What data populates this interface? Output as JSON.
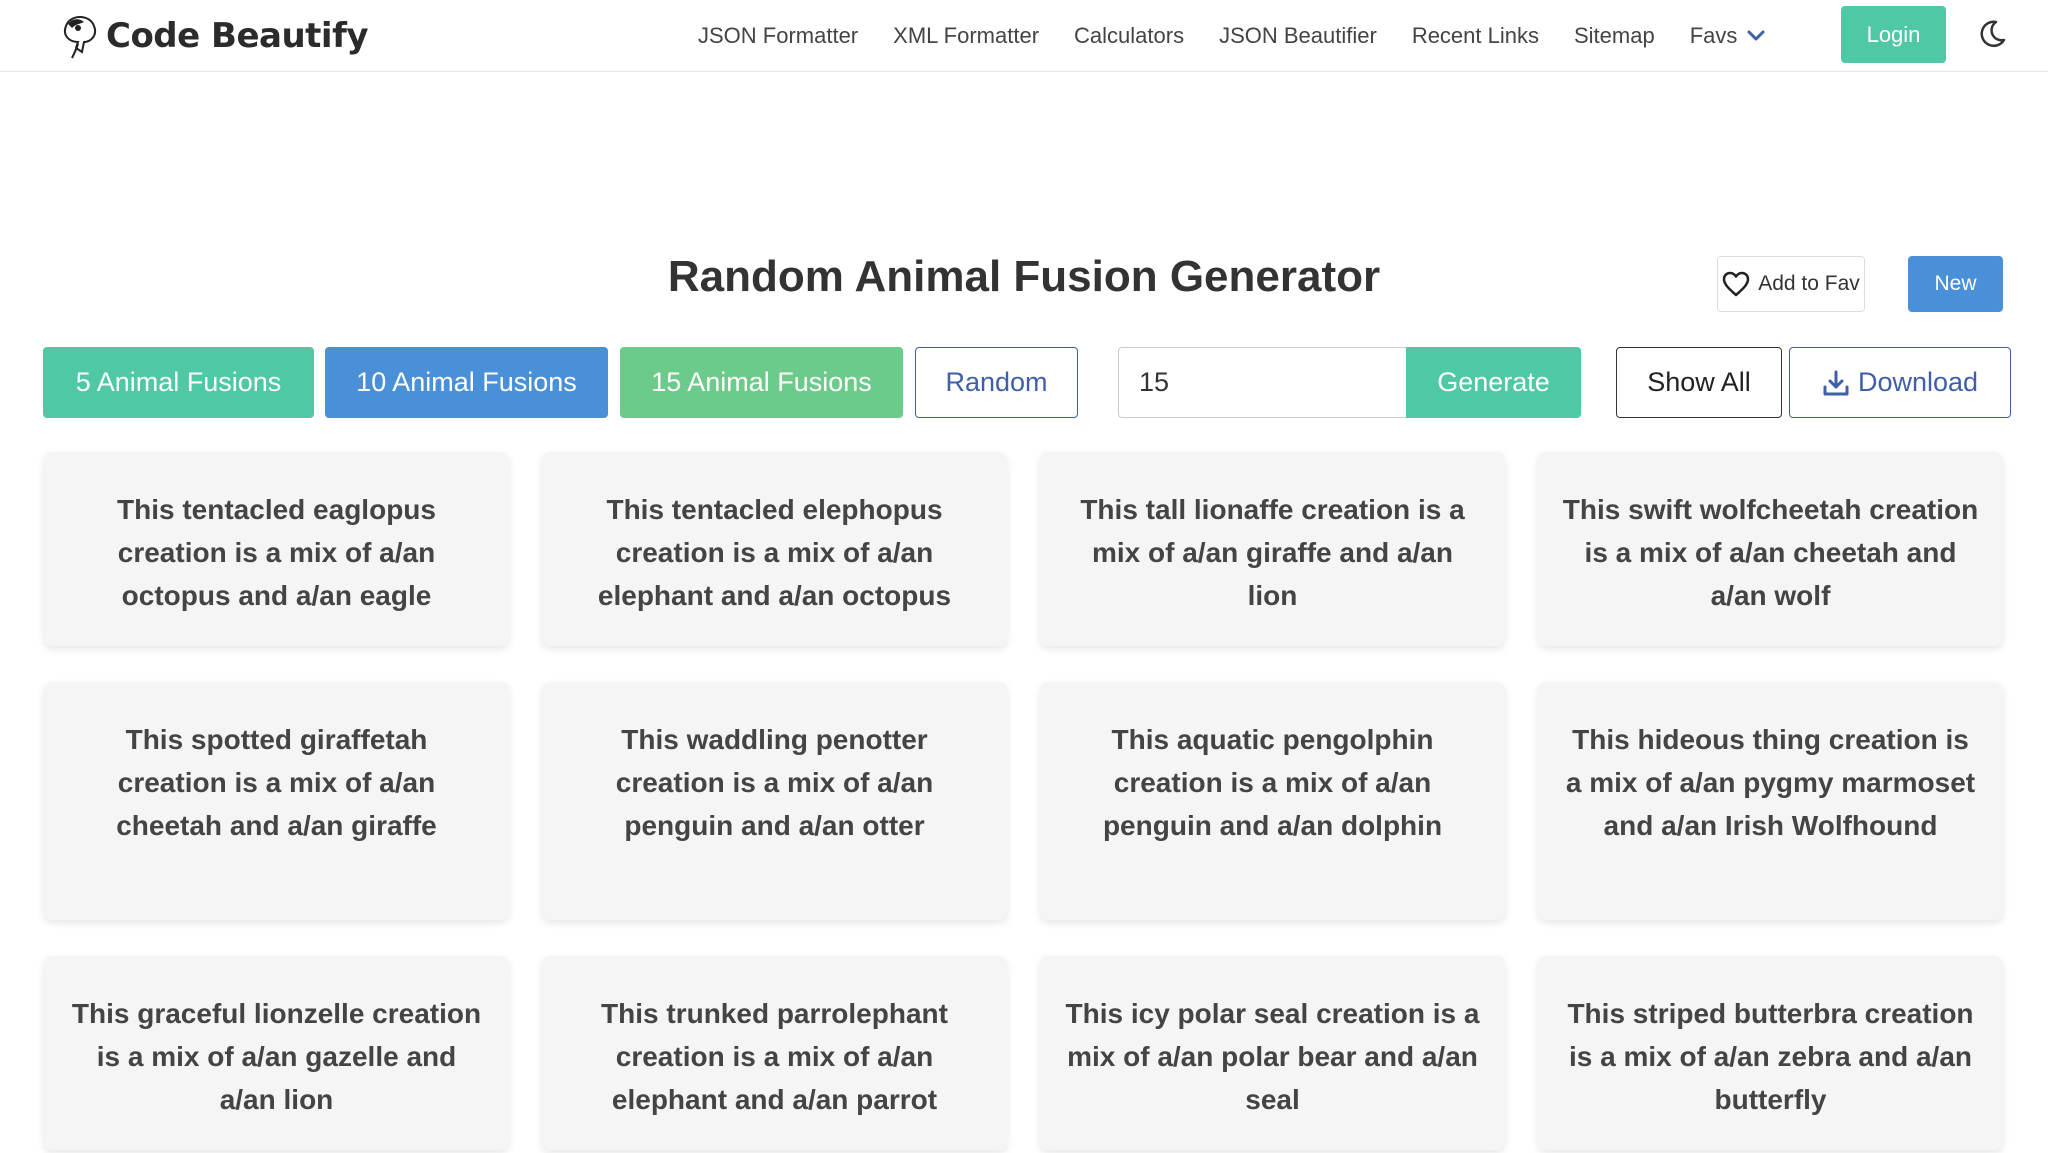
{
  "brand": {
    "name": "Code Beautify"
  },
  "nav": {
    "links": [
      "JSON Formatter",
      "XML Formatter",
      "Calculators",
      "JSON Beautifier",
      "Recent Links",
      "Sitemap"
    ],
    "favs_label": "Favs",
    "login_label": "Login"
  },
  "page": {
    "title": "Random Animal Fusion Generator",
    "add_to_fav_label": "Add to Fav",
    "new_label": "New"
  },
  "controls": {
    "five_label": "5 Animal Fusions",
    "ten_label": "10 Animal Fusions",
    "fifteen_label": "15 Animal Fusions",
    "random_label": "Random",
    "count_value": "15",
    "generate_label": "Generate",
    "show_all_label": "Show All",
    "download_label": "Download"
  },
  "results": [
    "This tentacled eaglopus creation is a mix of a/an octopus and a/an eagle",
    "This tentacled elephopus creation is a mix of a/an elephant and a/an octopus",
    "This tall lionaffe creation is a mix of a/an giraffe and a/an lion",
    "This swift wolfcheetah creation is a mix of a/an cheetah and a/an wolf",
    "This spotted giraffetah creation is a mix of a/an cheetah and a/an giraffe",
    "This waddling penotter creation is a mix of a/an penguin and a/an otter",
    "This aquatic pengolphin creation is a mix of a/an penguin and a/an dolphin",
    "This hideous thing creation is a mix of a/an pygmy marmoset and a/an Irish Wolfhound",
    "This graceful lionzelle creation is a mix of a/an gazelle and a/an lion",
    "This trunked parrolephant creation is a mix of a/an elephant and a/an parrot",
    "This icy polar seal creation is a mix of a/an polar bear and a/an seal",
    "This striped butterbra creation is a mix of a/an zebra and a/an butterfly"
  ],
  "colors": {
    "green": "#4fc9a5",
    "blue": "#4a90d9",
    "light_green": "#6ccb8a",
    "outline_blue": "#3f5fa8"
  },
  "icons": [
    "brand-logo-icon",
    "chevron-down-icon",
    "moon-icon",
    "heart-icon",
    "download-icon"
  ]
}
